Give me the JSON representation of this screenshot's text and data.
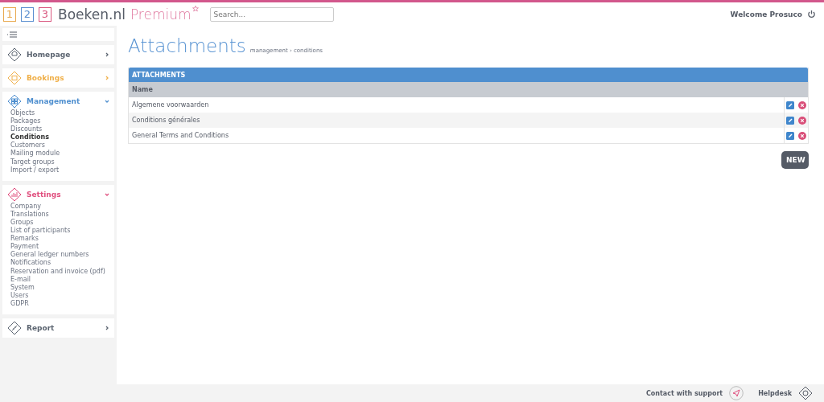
{
  "header": {
    "logo_digits": [
      {
        "text": "1",
        "color": "#e8a94f"
      },
      {
        "text": "2",
        "color": "#5b8fd0"
      },
      {
        "text": "3",
        "color": "#d9577f"
      }
    ],
    "logo_name": "Boeken.nl",
    "logo_edition": "Premium",
    "search": {
      "placeholder": "Search..."
    },
    "welcome": "Welcome Prosuco"
  },
  "sidebar": {
    "sections": [
      {
        "label": "Homepage",
        "color": "#5b6470",
        "expanded": false
      },
      {
        "label": "Bookings",
        "color": "#f0b04a",
        "expanded": false
      },
      {
        "label": "Management",
        "color": "#4f8fcf",
        "expanded": true,
        "items": [
          {
            "label": "Objects",
            "selected": false
          },
          {
            "label": "Packages",
            "selected": false
          },
          {
            "label": "Discounts",
            "selected": false
          },
          {
            "label": "Conditions",
            "selected": true
          },
          {
            "label": "Customers",
            "selected": false
          },
          {
            "label": "Mailing module",
            "selected": false
          },
          {
            "label": "Target groups",
            "selected": false
          },
          {
            "label": "Import / export",
            "selected": false
          }
        ]
      },
      {
        "label": "Settings",
        "color": "#e0507f",
        "expanded": true,
        "items": [
          {
            "label": "Company",
            "selected": false
          },
          {
            "label": "Translations",
            "selected": false
          },
          {
            "label": "Groups",
            "selected": false
          },
          {
            "label": "List of participants",
            "selected": false
          },
          {
            "label": "Remarks",
            "selected": false
          },
          {
            "label": "Payment",
            "selected": false
          },
          {
            "label": "General ledger numbers",
            "selected": false
          },
          {
            "label": "Notifications",
            "selected": false
          },
          {
            "label": "Reservation and invoice (pdf)",
            "selected": false
          },
          {
            "label": "E-mail",
            "selected": false
          },
          {
            "label": "System",
            "selected": false
          },
          {
            "label": "Users",
            "selected": false
          },
          {
            "label": "GDPR",
            "selected": false
          }
        ]
      },
      {
        "label": "Report",
        "color": "#5b6470",
        "expanded": false
      }
    ]
  },
  "page": {
    "title": "Attachments",
    "breadcrumb": "management › conditions"
  },
  "table": {
    "title": "ATTACHMENTS",
    "columns": [
      "Name"
    ],
    "rows": [
      [
        "Algemene voorwaarden"
      ],
      [
        "Conditions générales"
      ],
      [
        "General Terms and Conditions"
      ]
    ]
  },
  "new_button": "NEW",
  "footer": {
    "support": "Contact with support",
    "helpdesk": "Helpdesk"
  }
}
